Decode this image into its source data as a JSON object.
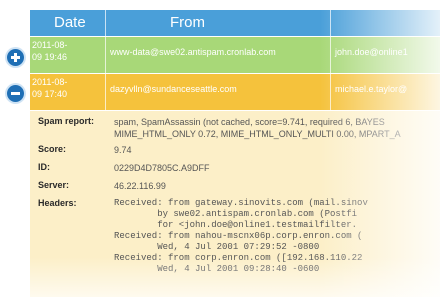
{
  "table": {
    "col_date": "Date",
    "col_from": "From"
  },
  "rows": [
    {
      "date_line1": "2011-08-",
      "date_line2": "09 19:46",
      "from": "www-data@swe02.antispam.cronlab.com",
      "to": "john.doe@online1"
    },
    {
      "date_line1": "2011-08-",
      "date_line2": "09 17:40",
      "from": "dazyvlln@sundanceseattle.com",
      "to": "michael.e.taylor@"
    }
  ],
  "detail": {
    "spam_report_label": "Spam report:",
    "spam_report_line1": "spam, SpamAssassin (not cached, score=9.741, required 6, BAYES",
    "spam_report_line2": "MIME_HTML_ONLY 0.72, MIME_HTML_ONLY_MULTI 0.00, MPART_A",
    "score_label": "Score:",
    "score": "9.74",
    "id_label": "ID:",
    "id": "0229D4D7805C.A9DFF",
    "server_label": "Server:",
    "server": "46.22.116.99",
    "headers_label": "Headers:",
    "headers_lines": [
      "Received: from gateway.sinovits.com (mail.sinov",
      "        by swe02.antispam.cronlab.com (Postfi",
      "        for <john.doe@online1.testmailfilter.",
      "Received: from nahou-mscnx06p.corp.enron.com (",
      "        Wed, 4 Jul 2001 07:29:52 -0800",
      "Received: from corp.enron.com ([192.168.110.22",
      "        Wed, 4 Jul 2001 09:28:40 -0600"
    ]
  }
}
